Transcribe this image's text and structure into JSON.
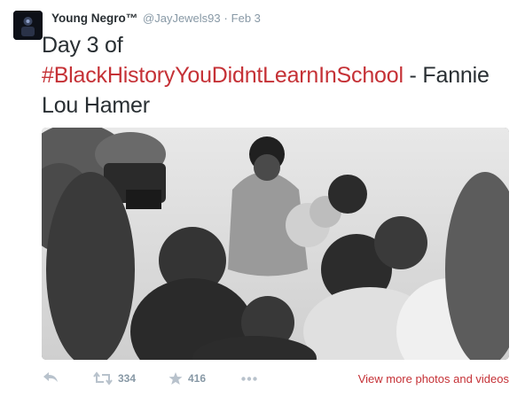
{
  "tweet": {
    "display_name": "Young Negro™",
    "handle": "@JayJewels93",
    "separator": "·",
    "date": "Feb 3",
    "text_before": "Day 3 of ",
    "hashtag": "#BlackHistoryYouDidntLearnInSchool",
    "text_after": " - Fannie Lou Hamer"
  },
  "actions": {
    "reply_icon": "reply-icon",
    "retweet_icon": "retweet-icon",
    "retweet_count": "334",
    "favorite_icon": "star-icon",
    "favorite_count": "416",
    "more_icon": "more-icon",
    "view_more_label": "View more photos and videos"
  },
  "colors": {
    "hashtag": "#c53136",
    "meta": "#8899a6",
    "text": "#292f33"
  }
}
